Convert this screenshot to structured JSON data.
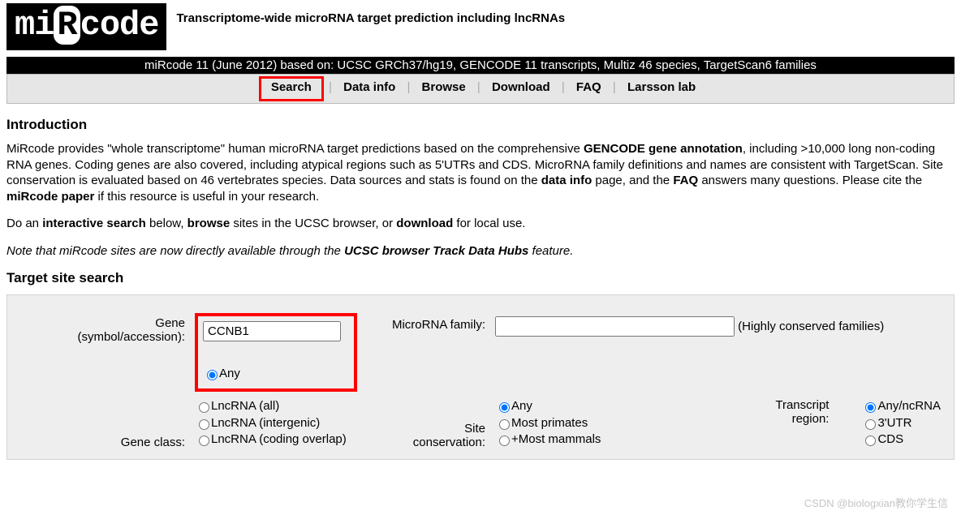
{
  "header": {
    "logo_prefix": "mi",
    "logo_invert": "R",
    "logo_suffix": "code",
    "tagline": "Transcriptome-wide microRNA target prediction including lncRNAs"
  },
  "version_bar": "miRcode 11 (June 2012) based on: UCSC GRCh37/hg19, GENCODE 11 transcripts, Multiz 46 species, TargetScan6 families",
  "nav": {
    "items": [
      "Search",
      "Data info",
      "Browse",
      "Download",
      "FAQ",
      "Larsson lab"
    ]
  },
  "intro": {
    "heading": "Introduction",
    "p1_a": "MiRcode provides \"whole transcriptome\" human microRNA target predictions based on the comprehensive ",
    "p1_b_bold": "GENCODE gene annotation",
    "p1_c": ", including >10,000 long non-coding RNA genes. Coding genes are also covered, including atypical regions such as 5'UTRs and CDS. MicroRNA family definitions and names are consistent with TargetScan. Site conservation is evaluated based on 46 vertebrates species. Data sources and stats is found on the ",
    "p1_d_bold": "data info",
    "p1_e": " page, and the ",
    "p1_f_bold": "FAQ",
    "p1_g": " answers many questions. Please cite the ",
    "p1_h_bold": "miRcode paper",
    "p1_i": " if this resource is useful in your research.",
    "p2_a": "Do an ",
    "p2_b_bold": "interactive search",
    "p2_c": " below, ",
    "p2_d_bold": "browse",
    "p2_e": " sites in the UCSC browser, or ",
    "p2_f_bold": "download",
    "p2_g": " for local use.",
    "p3_a": "Note that miRcode sites are now directly available through the ",
    "p3_b_bold": "UCSC browser Track Data Hubs",
    "p3_c": " feature."
  },
  "search": {
    "heading": "Target site search",
    "gene_label_1": "Gene",
    "gene_label_2": "(symbol/accession):",
    "gene_value": "CCNB1",
    "mirna_label": "MicroRNA family:",
    "mirna_value": "",
    "mirna_hint": "(Highly conserved families)",
    "gene_class_label": "Gene class:",
    "gene_class_options": [
      "Any",
      "LncRNA (all)",
      "LncRNA (intergenic)",
      "LncRNA (coding overlap)"
    ],
    "gene_class_selected": 0,
    "siteconserv_label_1": "Site",
    "siteconserv_label_2": "conservation:",
    "siteconserv_options": [
      "Any",
      "Most primates",
      "+Most mammals"
    ],
    "siteconserv_selected": 0,
    "region_label_1": "Transcript",
    "region_label_2": "region:",
    "region_options": [
      "Any/ncRNA",
      "3'UTR",
      "CDS"
    ],
    "region_selected": 0
  },
  "watermark": "CSDN @biologxian教你学生信"
}
